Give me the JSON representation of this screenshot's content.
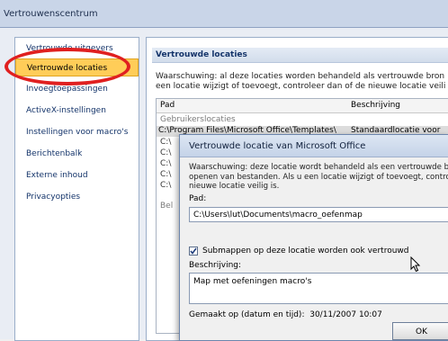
{
  "window": {
    "title": "Vertrouwenscentrum"
  },
  "sidebar": {
    "items": [
      {
        "label": "Vertrouwde uitgevers",
        "active": false
      },
      {
        "label": "Vertrouwde locaties",
        "active": true
      },
      {
        "label": "Invoegtoepassingen",
        "active": false
      },
      {
        "label": "ActiveX-instellingen",
        "active": false
      },
      {
        "label": "Instellingen voor macro's",
        "active": false
      },
      {
        "label": "Berichtenbalk",
        "active": false
      },
      {
        "label": "Externe inhoud",
        "active": false
      },
      {
        "label": "Privacyopties",
        "active": false
      }
    ]
  },
  "main": {
    "section_title": "Vertrouwde locaties",
    "warning_line1": "Waarschuwing: al deze locaties worden behandeld als vertrouwde bron",
    "warning_line2": "een locatie wijzigt of toevoegt, controleer dan of de nieuwe locatie veili",
    "table": {
      "col_path": "Pad",
      "col_desc": "Beschrijving",
      "group_user": "Gebruikerslocaties",
      "row1_path": "C:\\Program Files\\Microsoft Office\\Templates\\",
      "row1_desc": "Standaardlocatie voor",
      "partial_rows": [
        "C:\\",
        "C:\\",
        "C:\\",
        "C:\\",
        "C:\\"
      ],
      "group_policy_partial": "Bel"
    }
  },
  "dialog": {
    "title": "Vertrouwde locatie van Microsoft Office",
    "warning_line1": "Waarschuwing: deze locatie wordt behandeld als een vertrouwde bro",
    "warning_line2": "openen van bestanden. Als u een locatie wijzigt of toevoegt, controle",
    "warning_line3": "nieuwe locatie veilig is.",
    "path_label": "Pad:",
    "path_value": "C:\\Users\\lut\\Documents\\macro_oefenmap",
    "subfolders_label": "Submappen op deze locatie worden ook vertrouwd",
    "subfolders_checked": true,
    "desc_label": "Beschrijving:",
    "desc_value": "Map met oefeningen macro's",
    "created_label": "Gemaakt op (datum en tijd):",
    "created_value": "30/11/2007 10:07",
    "ok_label": "OK"
  },
  "colors": {
    "active_item": "#ffcd58",
    "highlight_ring": "#e02020",
    "nav_text": "#14346a"
  }
}
